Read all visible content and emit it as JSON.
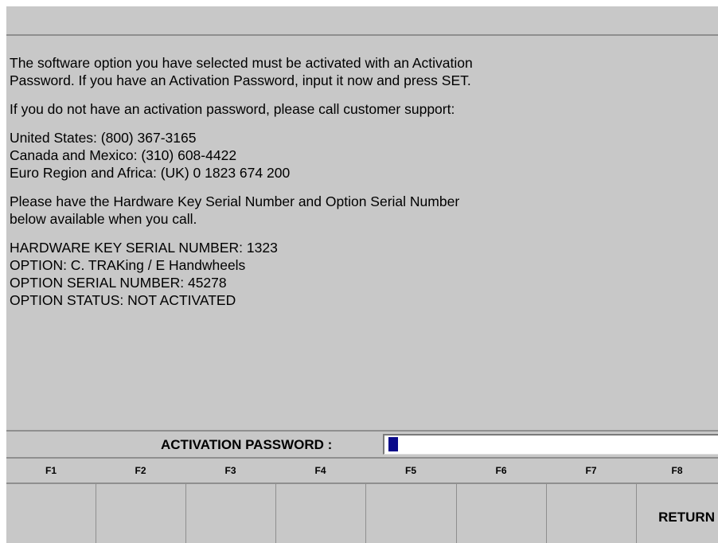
{
  "message": {
    "para1_line1": "The software option you have selected must be activated with an Activation",
    "para1_line2": "Password.  If you have an Activation Password, input it now and press SET.",
    "para2": "If you do not have an activation password, please call customer support:",
    "contacts": [
      "United States: (800) 367-3165",
      "Canada and Mexico: (310) 608-4422",
      "Euro Region and Africa: (UK) 0 1823 674 200"
    ],
    "para3_line1": "Please have the Hardware Key Serial Number and Option Serial Number",
    "para3_line2": "below available when you call.",
    "details": [
      "HARDWARE KEY SERIAL NUMBER:  1323",
      "OPTION: C.  TRAKing / E Handwheels",
      "OPTION SERIAL NUMBER:  45278",
      "OPTION STATUS:  NOT ACTIVATED"
    ]
  },
  "password": {
    "label": "ACTIVATION PASSWORD :",
    "value": "",
    "cursor_color": "#0a0a8a"
  },
  "function_keys": [
    {
      "key": "F1",
      "label": ""
    },
    {
      "key": "F2",
      "label": ""
    },
    {
      "key": "F3",
      "label": ""
    },
    {
      "key": "F4",
      "label": ""
    },
    {
      "key": "F5",
      "label": ""
    },
    {
      "key": "F6",
      "label": ""
    },
    {
      "key": "F7",
      "label": ""
    },
    {
      "key": "F8",
      "label": "RETURN"
    }
  ],
  "colors": {
    "background": "#c8c8c8",
    "divider": "#8f8f8f",
    "input_background": "#ffffff"
  }
}
